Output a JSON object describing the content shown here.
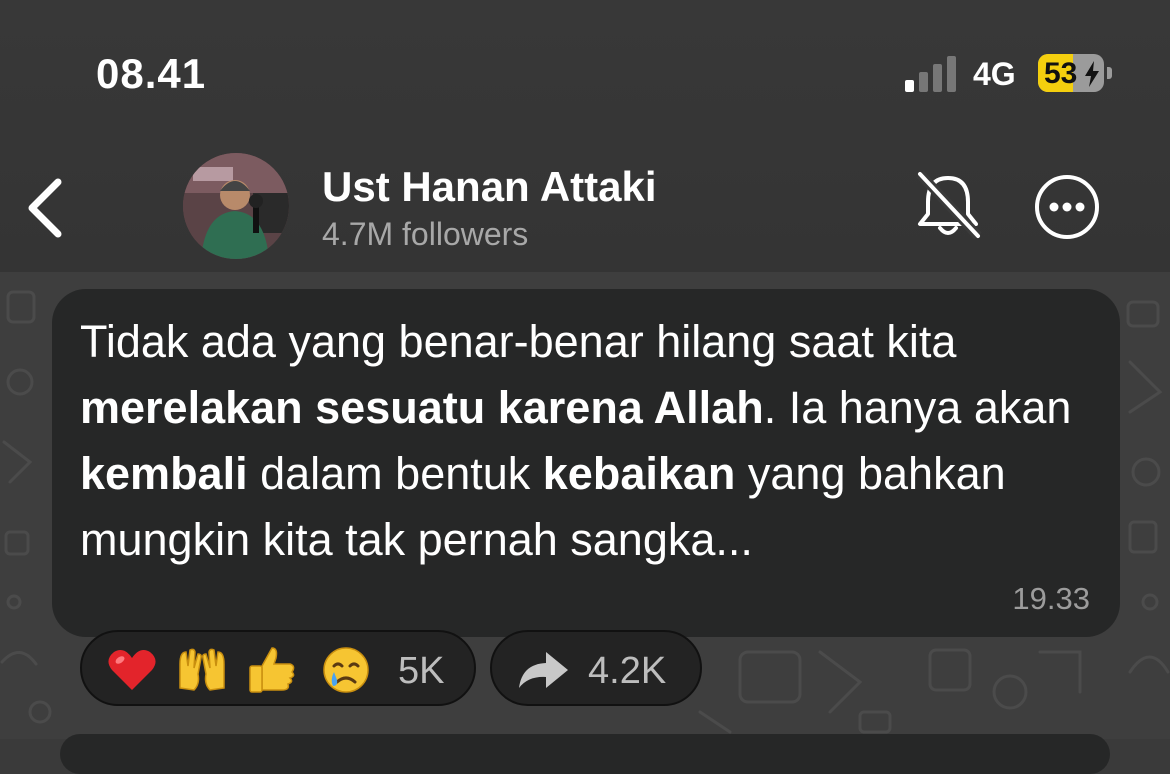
{
  "status_bar": {
    "time": "08.41",
    "network": "4G",
    "battery": "53"
  },
  "header": {
    "channel_name": "Ust Hanan Attaki",
    "followers": "4.7M followers"
  },
  "message": {
    "segments": [
      {
        "text": "Tidak ada yang benar-benar hilang saat kita ",
        "bold": false
      },
      {
        "text": "merelakan sesuatu karena Allah",
        "bold": true
      },
      {
        "text": ". Ia hanya akan ",
        "bold": false
      },
      {
        "text": "kembali",
        "bold": true
      },
      {
        "text": " dalam bentuk ",
        "bold": false
      },
      {
        "text": "kebaikan",
        "bold": true
      },
      {
        "text": " yang bahkan mungkin kita tak pernah sangka...",
        "bold": false
      }
    ],
    "time": "19.33"
  },
  "reactions": {
    "emojis": [
      "red-heart",
      "raising-hands",
      "thumbs-up",
      "crying-face"
    ],
    "count": "5K"
  },
  "share": {
    "count": "4.2K"
  },
  "colors": {
    "header_bg": "#383838",
    "bubble_bg": "#262727",
    "battery_yellow": "#f4cf0e",
    "muted_text": "#a8a8a8"
  }
}
